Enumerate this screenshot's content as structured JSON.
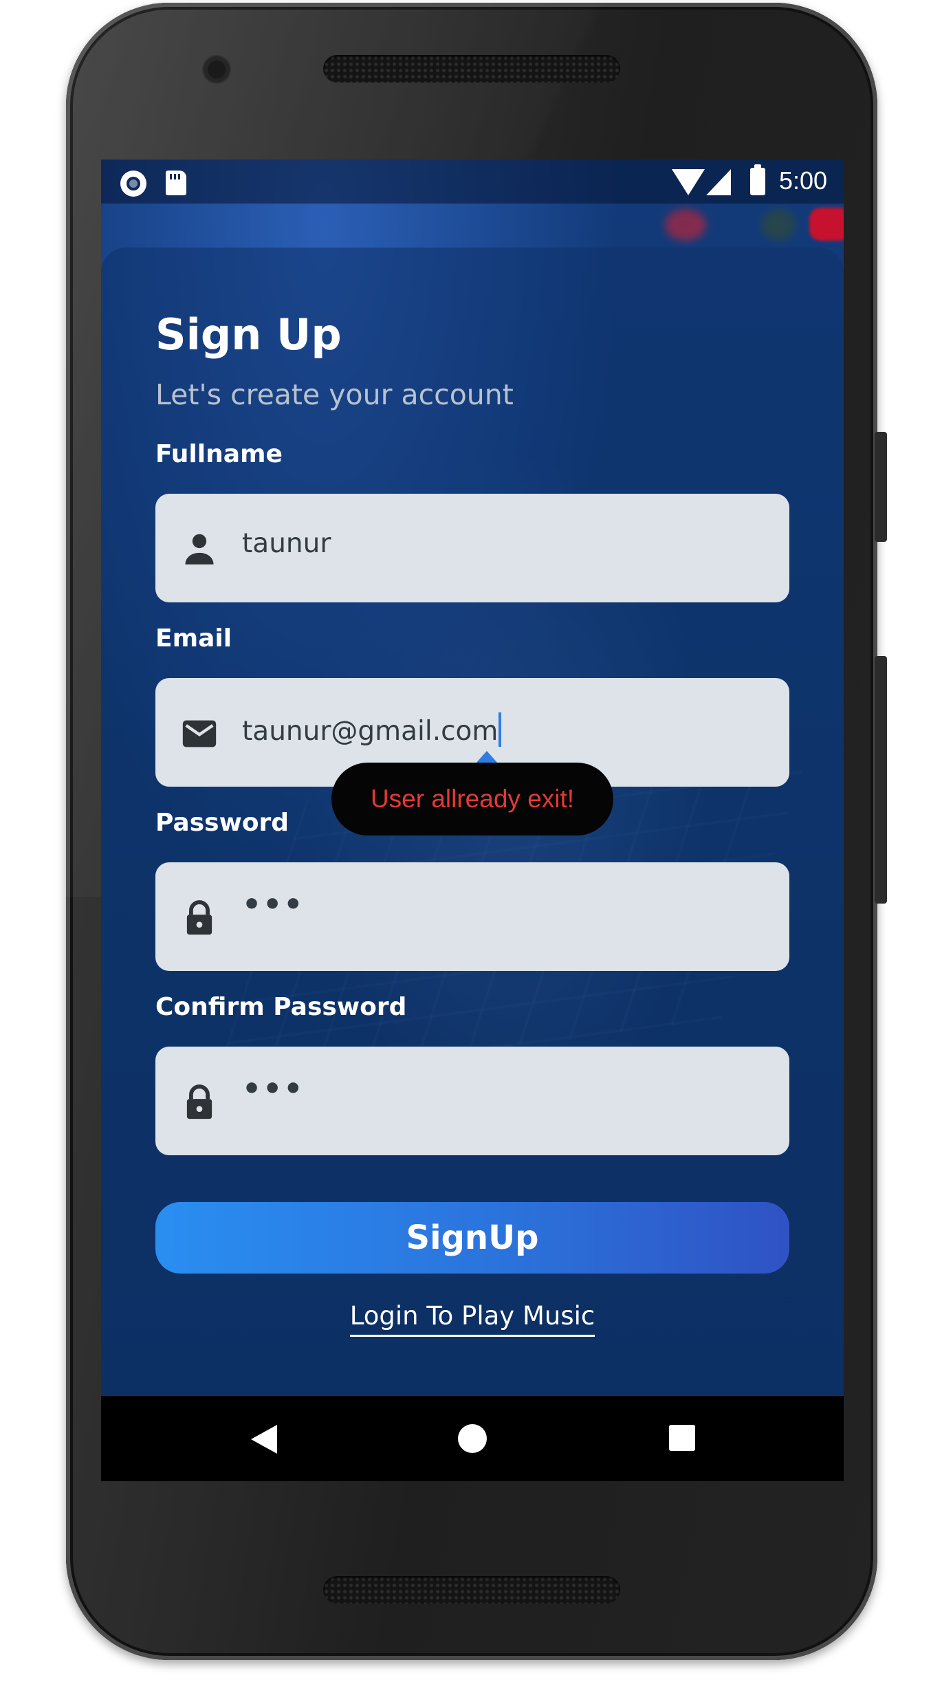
{
  "status_bar": {
    "time": "5:00",
    "icons": [
      "sync-icon",
      "sd-card-icon",
      "wifi-icon",
      "cell-signal-icon",
      "battery-icon"
    ]
  },
  "signup": {
    "title": "Sign Up",
    "subtitle": "Let's create your account",
    "fields": [
      {
        "label": "Fullname",
        "value": "taunur",
        "icon": "person-icon"
      },
      {
        "label": "Email",
        "value": "taunur@gmail.com",
        "icon": "mail-icon"
      },
      {
        "label": "Password",
        "value": "•••",
        "icon": "lock-icon"
      },
      {
        "label": "Confirm Password",
        "value": "•••",
        "icon": "lock-icon"
      }
    ],
    "toast": "User allready exit!",
    "submit_label": "SignUp",
    "login_link": "Login To Play Music"
  },
  "colors": {
    "background": "#0f3a74",
    "input_bg": "#dde3e8",
    "button_start": "#2a8ef1",
    "button_end": "#2f52c4",
    "toast_text": "#e53935",
    "cursor": "#2f7de2"
  },
  "nav_bar": {
    "icons": [
      "back-icon",
      "home-icon",
      "recents-icon"
    ]
  }
}
